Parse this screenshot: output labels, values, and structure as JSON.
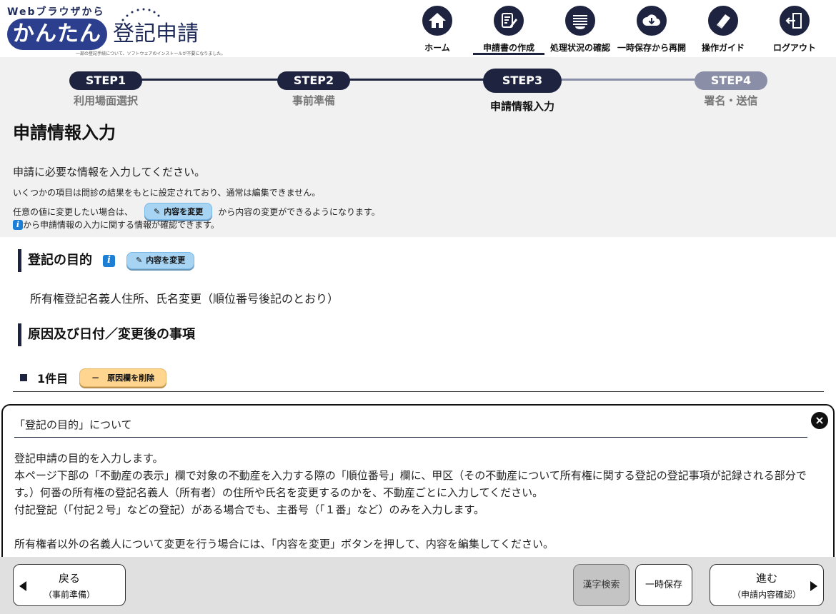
{
  "logo": {
    "top": "Webブラウザから",
    "kantan": "かんたん",
    "main": "登記申請",
    "sub": "一部の登記手続について、ソフトウェアのインストールが不要になりました。"
  },
  "nav": [
    {
      "label": "ホーム",
      "icon": "home-icon"
    },
    {
      "label": "申請書の作成",
      "icon": "edit-document-icon",
      "active": true
    },
    {
      "label": "処理状況の確認",
      "icon": "list-icon"
    },
    {
      "label": "一時保存から再開",
      "icon": "cloud-download-icon"
    },
    {
      "label": "操作ガイド",
      "icon": "book-icon"
    },
    {
      "label": "ログアウト",
      "icon": "logout-icon"
    }
  ],
  "steps": [
    {
      "pill": "STEP1",
      "label": "利用場面選択",
      "state": "done"
    },
    {
      "pill": "STEP2",
      "label": "事前準備",
      "state": "done"
    },
    {
      "pill": "STEP3",
      "label": "申請情報入力",
      "state": "current"
    },
    {
      "pill": "STEP4",
      "label": "署名・送信",
      "state": "future"
    }
  ],
  "page": {
    "title": "申請情報入力",
    "intro1": "申請に必要な情報を入力してください。",
    "intro2": "いくつかの項目は問診の結果をもとに設定されており、通常は編集できません。",
    "intro3_before": "任意の値に変更したい場合は、",
    "intro3_after": "から内容の変更ができるようになります。",
    "intro4": "から申請情報の入力に関する情報が確認できます。",
    "change_label": "内容を変更",
    "info_letter": "i"
  },
  "purpose": {
    "heading": "登記の目的",
    "text": "所有権登記名義人住所、氏名変更（順位番号後記のとおり）"
  },
  "cause": {
    "heading": "原因及び日付／変更後の事項",
    "item_title": "1件目",
    "delete_label": "－　原因欄を削除"
  },
  "info_panel": {
    "title": "「登記の目的」について",
    "close": "×",
    "p1": "登記申請の目的を入力します。",
    "p2": "本ページ下部の「不動産の表示」欄で対象の不動産を入力する際の「順位番号」欄に、甲区（その不動産について所有権に関する登記の登記事項が記録される部分です。）何番の所有権の登記名義人（所有者）の住所や氏名を変更するのかを、不動産ごとに入力してください。",
    "p3": "付記登記（「付記２号」などの登記）がある場合でも、主番号（「１番」など）のみを入力します。",
    "p4": "所有権者以外の名義人について変更を行う場合には、「内容を変更」ボタンを押して、内容を編集してください。"
  },
  "footer": {
    "back_l1": "戻る",
    "back_l2": "（事前準備）",
    "kanji": "漢字検索",
    "save": "一時保存",
    "next_l1": "進む",
    "next_l2": "（申請内容確認）"
  },
  "colors": {
    "primary": "#1e2440",
    "change_button": "#a8d4f3",
    "delete_button": "#ffd590",
    "info_blue": "#1d7ed6"
  }
}
